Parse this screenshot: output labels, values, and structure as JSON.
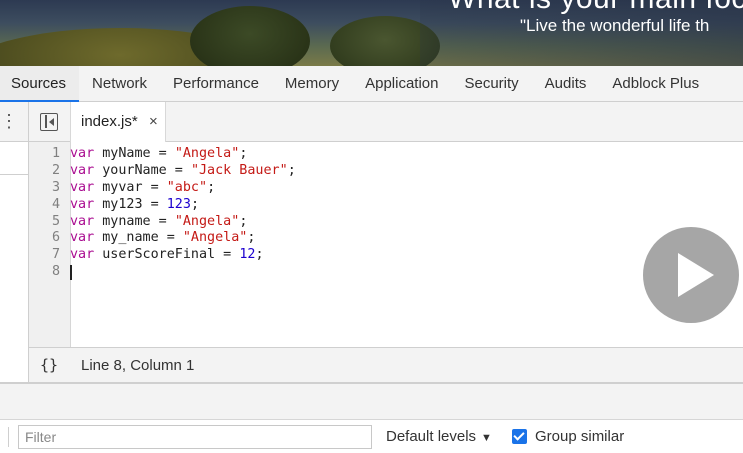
{
  "banner": {
    "headline": "What is your main foc",
    "quote": "\"Live the wonderful life th"
  },
  "devtools": {
    "tabs": [
      "Sources",
      "Network",
      "Performance",
      "Memory",
      "Application",
      "Security",
      "Audits",
      "Adblock Plus"
    ],
    "active_tab": "Sources"
  },
  "editor": {
    "open_file": "index.js*",
    "close_glyph": "×",
    "lines": [
      {
        "n": "1",
        "tokens": [
          {
            "t": "var",
            "c": "kw"
          },
          {
            "t": " myName = ",
            "c": ""
          },
          {
            "t": "\"Angela\"",
            "c": "str"
          },
          {
            "t": ";",
            "c": ""
          }
        ]
      },
      {
        "n": "2",
        "tokens": [
          {
            "t": "var",
            "c": "kw"
          },
          {
            "t": " yourName = ",
            "c": ""
          },
          {
            "t": "\"Jack Bauer\"",
            "c": "str"
          },
          {
            "t": ";",
            "c": ""
          }
        ]
      },
      {
        "n": "3",
        "tokens": [
          {
            "t": "var",
            "c": "kw"
          },
          {
            "t": " myvar = ",
            "c": ""
          },
          {
            "t": "\"abc\"",
            "c": "str"
          },
          {
            "t": ";",
            "c": ""
          }
        ]
      },
      {
        "n": "4",
        "tokens": [
          {
            "t": "var",
            "c": "kw"
          },
          {
            "t": " my123 = ",
            "c": ""
          },
          {
            "t": "123",
            "c": "num"
          },
          {
            "t": ";",
            "c": ""
          }
        ]
      },
      {
        "n": "5",
        "tokens": [
          {
            "t": "var",
            "c": "kw"
          },
          {
            "t": " myname = ",
            "c": ""
          },
          {
            "t": "\"Angela\"",
            "c": "str"
          },
          {
            "t": ";",
            "c": ""
          }
        ]
      },
      {
        "n": "6",
        "tokens": [
          {
            "t": "var",
            "c": "kw"
          },
          {
            "t": " my_name = ",
            "c": ""
          },
          {
            "t": "\"Angela\"",
            "c": "str"
          },
          {
            "t": ";",
            "c": ""
          }
        ]
      },
      {
        "n": "7",
        "tokens": [
          {
            "t": "var",
            "c": "kw"
          },
          {
            "t": " userScoreFinal = ",
            "c": ""
          },
          {
            "t": "12",
            "c": "num"
          },
          {
            "t": ";",
            "c": ""
          }
        ]
      },
      {
        "n": "8",
        "tokens": [],
        "caret": true
      }
    ]
  },
  "status": {
    "braces": "{}",
    "position": "Line 8, Column 1"
  },
  "console": {
    "filter_placeholder": "Filter",
    "levels_label": "Default levels",
    "levels_arrow": "▼",
    "group_similar_label": "Group similar",
    "group_similar_checked": true
  },
  "colors": {
    "keyword": "#aa0d91",
    "string": "#c41a16",
    "number": "#1c00cf",
    "accent": "#1a73e8"
  },
  "overlay": {
    "icon": "play-icon"
  }
}
